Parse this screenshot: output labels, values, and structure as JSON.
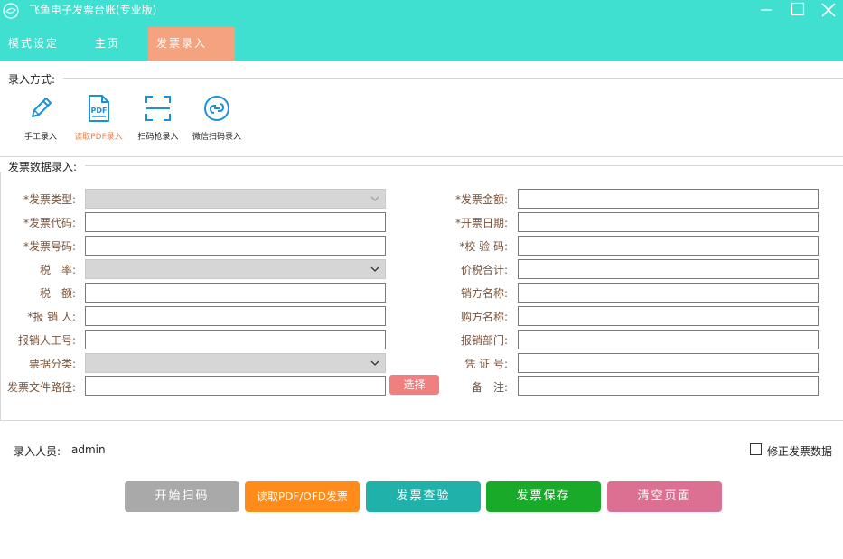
{
  "window": {
    "title": "飞鱼电子发票台账(专业版)"
  },
  "menu": {
    "items": [
      {
        "label": "模式设定"
      },
      {
        "label": "主页"
      },
      {
        "label": "发票录入"
      }
    ]
  },
  "entry_mode": {
    "section_label": "录入方式:",
    "modes": [
      {
        "label": "手工录入",
        "icon": "pencil-icon"
      },
      {
        "label": "读取PDF录入",
        "icon": "pdf-icon"
      },
      {
        "label": "扫码枪录入",
        "icon": "scan-icon"
      },
      {
        "label": "微信扫码录入",
        "icon": "wechat-link-icon"
      }
    ]
  },
  "form": {
    "section_label": "发票数据录入:",
    "left": {
      "invoice_type": "*发票类型:",
      "invoice_code": "*发票代码:",
      "invoice_number": "*发票号码:",
      "tax_rate": "税　率:",
      "tax_amount": "税　额:",
      "claimant": "*报 销 人:",
      "claimant_id": "报销人工号:",
      "doc_category": "票据分类:",
      "file_path": "发票文件路径:"
    },
    "right": {
      "amount": "*发票金额:",
      "issue_date": "*开票日期:",
      "check_code": "*校 验 码:",
      "total_with_tax": "价税合计:",
      "seller_name": "销方名称:",
      "buyer_name": "购方名称:",
      "department": "报销部门:",
      "voucher_no": "凭 证 号:",
      "remark": "备　注:"
    },
    "choose_button": "选择"
  },
  "footer": {
    "operator_label": "录入人员:",
    "operator_value": "admin",
    "fix_label": "修正发票数据"
  },
  "actions": {
    "start_scan": "开始扫码",
    "read_pdf": "读取PDF/OFD发票",
    "verify": "发票查验",
    "save": "发票保存",
    "clear": "清空页面"
  },
  "colors": {
    "brand": "#40e0d0",
    "active_tab": "#f5a27f",
    "start_scan": "#a9a9a9",
    "read_pdf": "#ff8c1a",
    "verify": "#20b2aa",
    "save": "#1aaa2a",
    "clear": "#db7093"
  }
}
